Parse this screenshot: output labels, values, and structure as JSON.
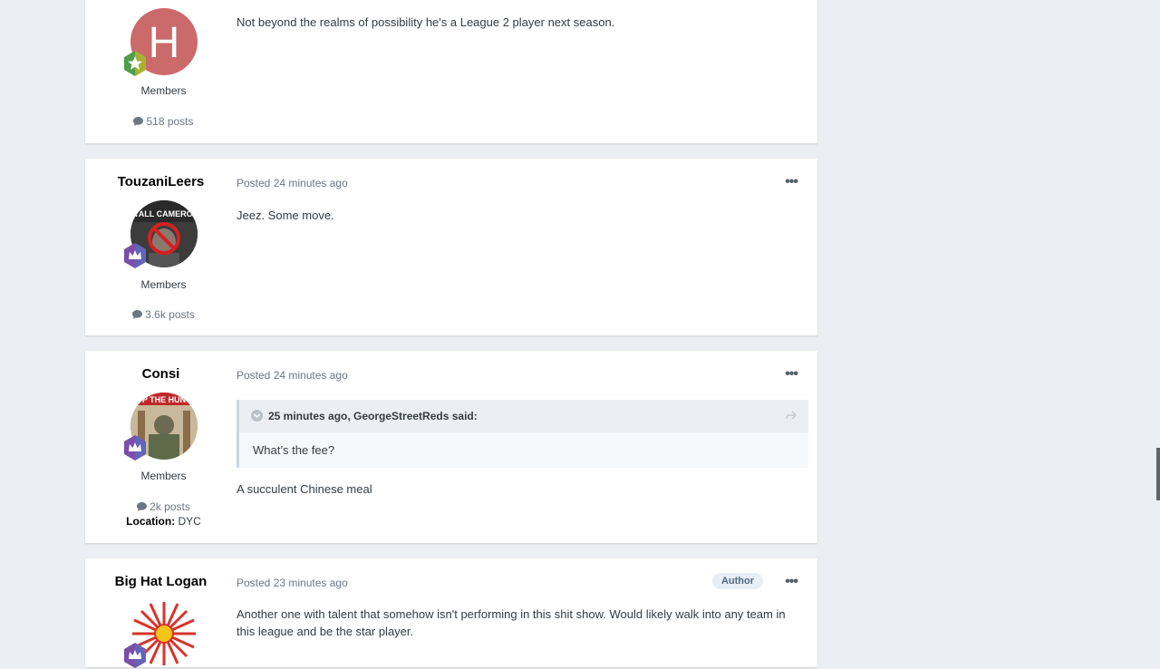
{
  "posts": [
    {
      "author": "",
      "avatar_letter": "H",
      "avatar_color": "#cb6a6a",
      "badge_icon": "star-icon",
      "group": "Members",
      "post_count": "518 posts",
      "posted": "",
      "content": "Not beyond the realms of possibility he's a League 2 player next season."
    },
    {
      "author": "TouzaniLeers",
      "avatar_caption": "LYALL CAMERON",
      "badge_icon": "crown-icon",
      "group": "Members",
      "post_count": "3.6k posts",
      "posted": "Posted 24 minutes ago",
      "content": "Jeez. Some move."
    },
    {
      "author": "Consi",
      "avatar_caption": "P THE HUN",
      "badge_icon": "crown-icon",
      "group": "Members",
      "post_count": "2k posts",
      "location_label": "Location:",
      "location_value": "DYC",
      "posted": "Posted 24 minutes ago",
      "quote": {
        "header": "25 minutes ago, GeorgeStreetReds said:",
        "body": "What’s the fee?"
      },
      "content": "A succulent Chinese meal"
    },
    {
      "author": "Big Hat Logan",
      "badge_icon": "crown-icon",
      "posted": "Posted 23 minutes ago",
      "tag": "Author",
      "content": "Another one with talent that somehow isn't performing in this shit show. Would likely walk into any team in this league and be the star player."
    }
  ],
  "menu_glyph": "•••"
}
